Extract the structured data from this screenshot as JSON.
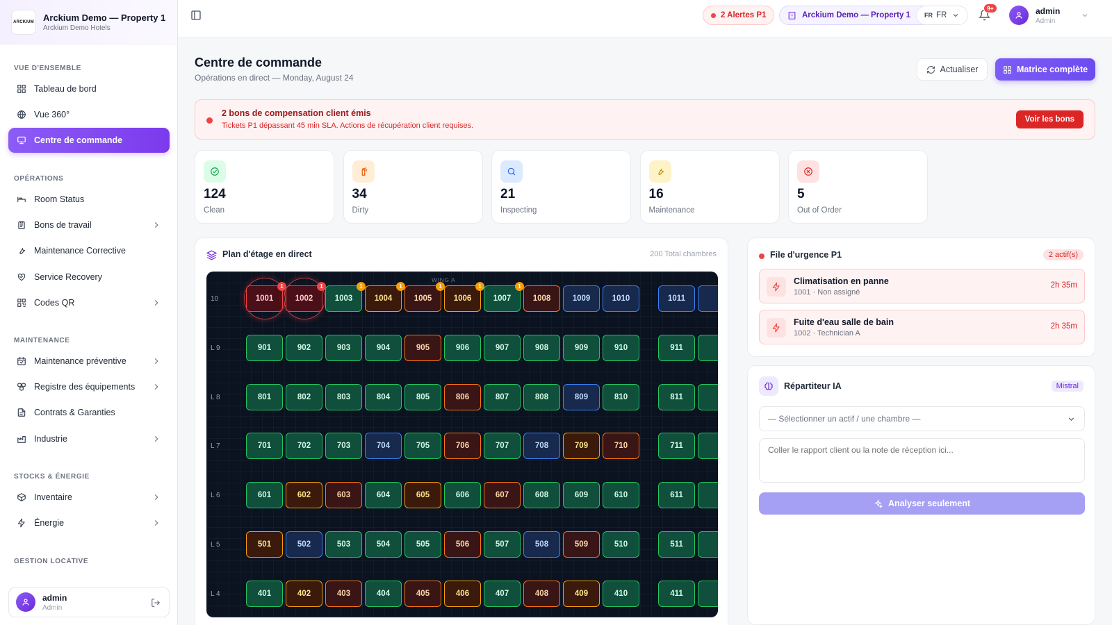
{
  "brand": {
    "logo_text": "ARCKIUM",
    "title": "Arckium Demo — Property 1",
    "subtitle": "Arckium Demo Hotels"
  },
  "sidebar": {
    "sections": [
      {
        "label": "VUE D'ENSEMBLE",
        "items": [
          {
            "label": "Tableau de bord",
            "icon": "dashboard-icon"
          },
          {
            "label": "Vue 360°",
            "icon": "globe-icon"
          },
          {
            "label": "Centre de commande",
            "icon": "monitor-icon",
            "active": true
          }
        ]
      },
      {
        "label": "OPÉRATIONS",
        "items": [
          {
            "label": "Room Status",
            "icon": "bed-icon"
          },
          {
            "label": "Bons de travail",
            "icon": "clipboard-icon",
            "chevron": true
          },
          {
            "label": "Maintenance Corrective",
            "icon": "wrench-icon"
          },
          {
            "label": "Service Recovery",
            "icon": "heart-handshake-icon"
          },
          {
            "label": "Codes QR",
            "icon": "qr-code-icon",
            "chevron": true
          }
        ]
      },
      {
        "label": "MAINTENANCE",
        "items": [
          {
            "label": "Maintenance préventive",
            "icon": "calendar-check-icon",
            "chevron": true
          },
          {
            "label": "Registre des équipements",
            "icon": "boxes-icon",
            "chevron": true
          },
          {
            "label": "Contrats & Garanties",
            "icon": "file-text-icon"
          },
          {
            "label": "Industrie",
            "icon": "factory-icon",
            "chevron": true
          }
        ]
      },
      {
        "label": "STOCKS & ÉNERGIE",
        "items": [
          {
            "label": "Inventaire",
            "icon": "package-icon",
            "chevron": true
          },
          {
            "label": "Énergie",
            "icon": "zap-icon",
            "chevron": true
          }
        ]
      },
      {
        "label": "GESTION LOCATIVE",
        "items": []
      }
    ],
    "user": {
      "name": "admin",
      "role": "Admin"
    }
  },
  "topbar": {
    "alerts": "2 Alertes P1",
    "property": "Arckium Demo — Property 1",
    "lang_flag": "FR",
    "lang": "FR",
    "notif_count": "9+",
    "user_name": "admin",
    "user_role": "Admin"
  },
  "page": {
    "title": "Centre de commande",
    "subtitle": "Opérations en direct — Monday, August 24",
    "refresh_label": "Actualiser",
    "matrix_label": "Matrice complète"
  },
  "banner": {
    "title": "2 bons de compensation client émis",
    "text": "Tickets P1 dépassant 45 min SLA. Actions de récupération client requises.",
    "button": "Voir les bons"
  },
  "stats": [
    {
      "value": "124",
      "label": "Clean",
      "icon": "check-circle-icon",
      "color": "#16a34a",
      "bg": "#dcfce7"
    },
    {
      "value": "34",
      "label": "Dirty",
      "icon": "spray-bottle-icon",
      "color": "#ea580c",
      "bg": "#ffedd5"
    },
    {
      "value": "21",
      "label": "Inspecting",
      "icon": "search-icon",
      "color": "#2563eb",
      "bg": "#dbeafe"
    },
    {
      "value": "16",
      "label": "Maintenance",
      "icon": "wrench-icon",
      "color": "#ca8a04",
      "bg": "#fef3c7"
    },
    {
      "value": "5",
      "label": "Out of Order",
      "icon": "x-circle-icon",
      "color": "#dc2626",
      "bg": "#fee2e2"
    }
  ],
  "floorplan": {
    "title": "Plan d'étage en direct",
    "total": "200 Total chambres",
    "wing": "WING A",
    "floors": [
      {
        "label": "10",
        "rooms": [
          [
            "1001",
            "ooo",
            "1"
          ],
          [
            "1002",
            "ooo",
            "1"
          ],
          [
            "1003",
            "clean",
            "1"
          ],
          [
            "1004",
            "dirty",
            "1"
          ],
          [
            "1005",
            "dirty2",
            "1"
          ],
          [
            "1006",
            "dirty",
            "1"
          ],
          [
            "1007",
            "clean",
            "1"
          ],
          [
            "1008",
            "dirty2",
            ""
          ],
          [
            "1009",
            "insp",
            ""
          ],
          [
            "1010",
            "insp",
            ""
          ],
          [
            "1011",
            "insp",
            ""
          ]
        ]
      },
      {
        "label": "L 9",
        "rooms": [
          [
            "901",
            "clean",
            ""
          ],
          [
            "902",
            "clean",
            ""
          ],
          [
            "903",
            "clean",
            ""
          ],
          [
            "904",
            "clean",
            ""
          ],
          [
            "905",
            "dirty2",
            ""
          ],
          [
            "906",
            "clean",
            ""
          ],
          [
            "907",
            "clean",
            ""
          ],
          [
            "908",
            "clean",
            ""
          ],
          [
            "909",
            "clean",
            ""
          ],
          [
            "910",
            "clean",
            ""
          ],
          [
            "911",
            "clean",
            ""
          ]
        ]
      },
      {
        "label": "L 8",
        "rooms": [
          [
            "801",
            "clean",
            ""
          ],
          [
            "802",
            "clean",
            ""
          ],
          [
            "803",
            "clean",
            ""
          ],
          [
            "804",
            "clean",
            ""
          ],
          [
            "805",
            "clean",
            ""
          ],
          [
            "806",
            "dirty2",
            ""
          ],
          [
            "807",
            "clean",
            ""
          ],
          [
            "808",
            "clean",
            ""
          ],
          [
            "809",
            "insp",
            ""
          ],
          [
            "810",
            "clean",
            ""
          ],
          [
            "811",
            "clean",
            ""
          ]
        ]
      },
      {
        "label": "L 7",
        "rooms": [
          [
            "701",
            "clean",
            ""
          ],
          [
            "702",
            "clean",
            ""
          ],
          [
            "703",
            "clean",
            ""
          ],
          [
            "704",
            "insp",
            ""
          ],
          [
            "705",
            "clean",
            ""
          ],
          [
            "706",
            "dirty2",
            ""
          ],
          [
            "707",
            "clean",
            ""
          ],
          [
            "708",
            "insp",
            ""
          ],
          [
            "709",
            "dirty",
            ""
          ],
          [
            "710",
            "dirty2",
            ""
          ],
          [
            "711",
            "clean",
            ""
          ]
        ]
      },
      {
        "label": "L 6",
        "rooms": [
          [
            "601",
            "clean",
            ""
          ],
          [
            "602",
            "dirty",
            ""
          ],
          [
            "603",
            "dirty2",
            ""
          ],
          [
            "604",
            "clean",
            ""
          ],
          [
            "605",
            "dirty",
            ""
          ],
          [
            "606",
            "clean",
            ""
          ],
          [
            "607",
            "dirty2",
            ""
          ],
          [
            "608",
            "clean",
            ""
          ],
          [
            "609",
            "clean",
            ""
          ],
          [
            "610",
            "clean",
            ""
          ],
          [
            "611",
            "clean",
            ""
          ]
        ]
      },
      {
        "label": "L 5",
        "rooms": [
          [
            "501",
            "dirty",
            ""
          ],
          [
            "502",
            "insp",
            ""
          ],
          [
            "503",
            "clean",
            ""
          ],
          [
            "504",
            "clean",
            ""
          ],
          [
            "505",
            "clean",
            ""
          ],
          [
            "506",
            "dirty2",
            ""
          ],
          [
            "507",
            "clean",
            ""
          ],
          [
            "508",
            "insp",
            ""
          ],
          [
            "509",
            "dirty2",
            ""
          ],
          [
            "510",
            "clean",
            ""
          ],
          [
            "511",
            "clean",
            ""
          ]
        ]
      },
      {
        "label": "L 4",
        "rooms": [
          [
            "401",
            "clean",
            ""
          ],
          [
            "402",
            "dirty",
            ""
          ],
          [
            "403",
            "dirty2",
            ""
          ],
          [
            "404",
            "clean",
            ""
          ],
          [
            "405",
            "dirty2",
            ""
          ],
          [
            "406",
            "dirty",
            ""
          ],
          [
            "407",
            "clean",
            ""
          ],
          [
            "408",
            "dirty2",
            ""
          ],
          [
            "409",
            "dirty",
            ""
          ],
          [
            "410",
            "clean",
            ""
          ],
          [
            "411",
            "clean",
            ""
          ]
        ]
      }
    ]
  },
  "urgent": {
    "title": "File d'urgence P1",
    "count": "2 actif(s)",
    "items": [
      {
        "title": "Climatisation en panne",
        "sub": "1001 · Non assigné",
        "time": "2h 35m"
      },
      {
        "title": "Fuite d'eau salle de bain",
        "sub": "1002 · Technician A",
        "time": "2h 35m"
      }
    ]
  },
  "dispatcher": {
    "title": "Répartiteur IA",
    "model": "Mistral",
    "select_placeholder": "— Sélectionner un actif / une chambre —",
    "textarea_placeholder": "Coller le rapport client ou la note de réception ici...",
    "analyze_label": "Analyser seulement"
  }
}
